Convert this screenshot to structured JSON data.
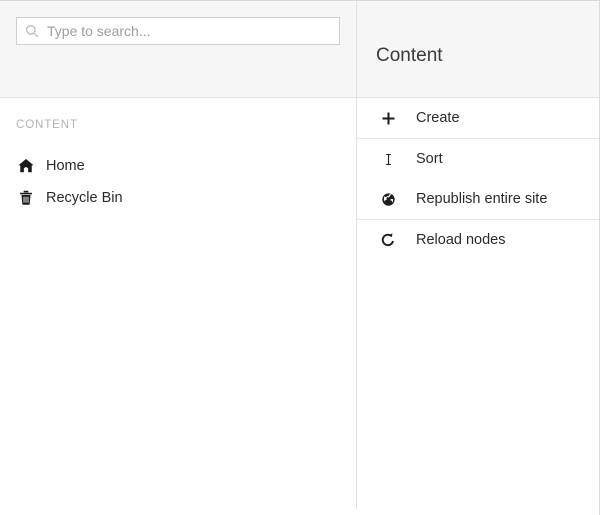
{
  "search": {
    "placeholder": "Type to search...",
    "value": "",
    "icon": "search-icon"
  },
  "sidebar": {
    "section_label": "CONTENT",
    "items": [
      {
        "label": "Home",
        "icon": "home-icon"
      },
      {
        "label": "Recycle Bin",
        "icon": "trash-icon"
      }
    ]
  },
  "panel": {
    "title": "Content",
    "groups": [
      {
        "items": [
          {
            "label": "Create",
            "icon": "plus-icon"
          }
        ]
      },
      {
        "items": [
          {
            "label": "Sort",
            "icon": "sort-icon"
          },
          {
            "label": "Republish entire site",
            "icon": "globe-icon"
          }
        ]
      },
      {
        "items": [
          {
            "label": "Reload nodes",
            "icon": "reload-icon"
          }
        ]
      }
    ]
  },
  "colors": {
    "header_bg": "#f6f6f6",
    "body_bg": "#ffffff",
    "border": "#e3e3e3",
    "divider": "#e0e0e0",
    "text": "#2b2b2b",
    "muted_text": "#b4b4b4",
    "placeholder": "#9d9d9d"
  }
}
